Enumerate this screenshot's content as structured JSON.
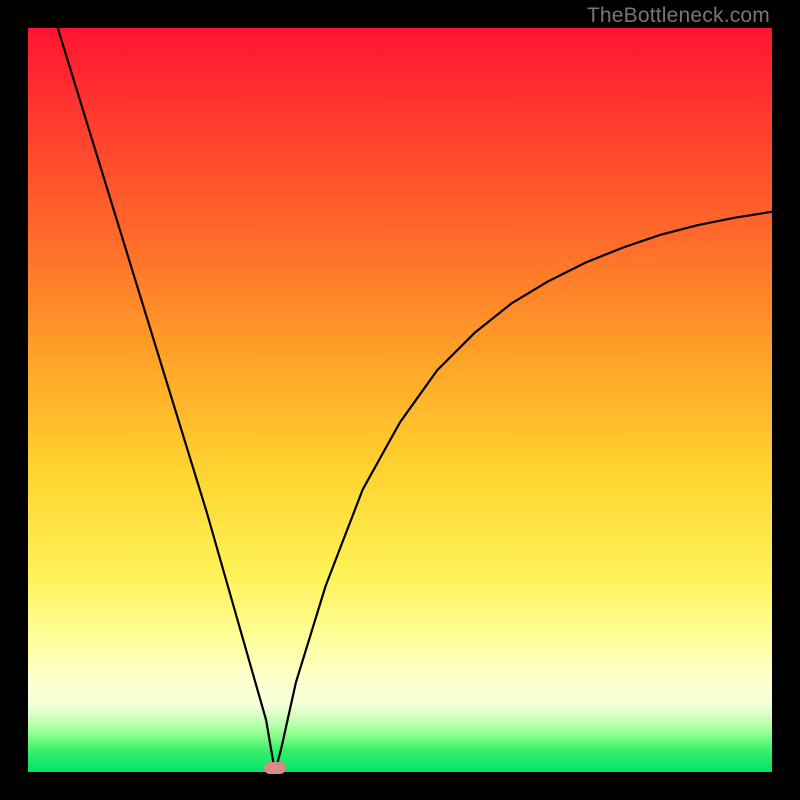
{
  "watermark": "TheBottleneck.com",
  "colors": {
    "frame": "#000000",
    "gradient_top": "#ff1430",
    "gradient_bottom": "#00e36a",
    "curve": "#000000",
    "marker": "#d98b86"
  },
  "chart_data": {
    "type": "line",
    "title": "",
    "xlabel": "",
    "ylabel": "",
    "xlim": [
      0,
      100
    ],
    "ylim": [
      0,
      100
    ],
    "grid": false,
    "legend": false,
    "series": [
      {
        "name": "bottleneck-curve",
        "x": [
          4,
          8,
          12,
          16,
          20,
          24,
          28,
          32,
          33.2,
          34,
          36,
          40,
          45,
          50,
          55,
          60,
          65,
          70,
          75,
          80,
          85,
          90,
          95,
          100
        ],
        "y": [
          100,
          87,
          74,
          61,
          48,
          35,
          21,
          7,
          0,
          3,
          12,
          25,
          38,
          47,
          54,
          59,
          63,
          66,
          68.5,
          70.5,
          72.2,
          73.5,
          74.5,
          75.3
        ]
      }
    ],
    "annotations": [
      {
        "name": "valley-marker",
        "shape": "pill",
        "x": 33.2,
        "y": 0.6
      }
    ]
  }
}
